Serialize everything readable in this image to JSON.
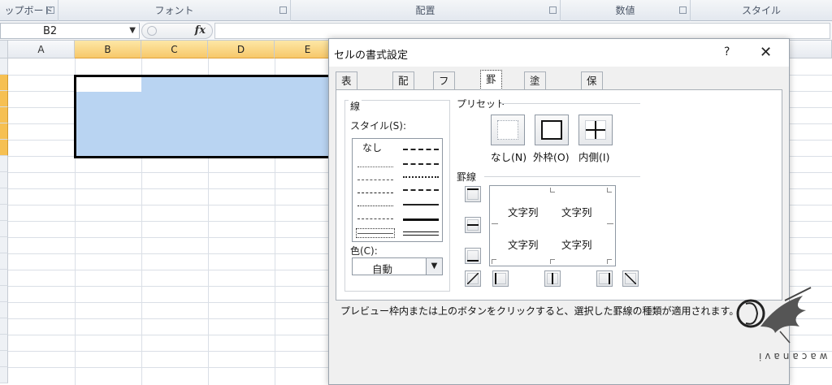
{
  "ribbon": {
    "groups": [
      {
        "label": "ップボード"
      },
      {
        "label": "フォント"
      },
      {
        "label": "配置"
      },
      {
        "label": "数値"
      },
      {
        "label": "スタイル"
      }
    ]
  },
  "formula_bar": {
    "name_box": "B2",
    "fx_label": "fx",
    "formula": ""
  },
  "sheet": {
    "columns": [
      "A",
      "B",
      "C",
      "D",
      "E"
    ],
    "selected_columns": [
      "B",
      "C",
      "D",
      "E"
    ],
    "active_cell": "B2"
  },
  "dialog": {
    "title": "セルの書式設定",
    "help": "?",
    "close": "✕",
    "tabs": [
      {
        "label": "表示形式"
      },
      {
        "label": "配置"
      },
      {
        "label": "フォント"
      },
      {
        "label": "罫線"
      },
      {
        "label": "塗りつぶし"
      },
      {
        "label": "保護"
      }
    ],
    "active_tab": "罫線",
    "line_group_title": "線",
    "style_label": "スタイル(S):",
    "style_none": "なし",
    "color_label": "色(C):",
    "color_value": "自動",
    "preset_title": "プリセット",
    "presets": [
      {
        "label": "なし(N)"
      },
      {
        "label": "外枠(O)"
      },
      {
        "label": "内側(I)"
      }
    ],
    "border_title": "罫線",
    "preview_texts": [
      "文字列",
      "文字列",
      "文字列",
      "文字列"
    ],
    "help_text": "プレビュー枠内または上のボタンをクリックすると、選択した罫線の種類が適用されます。"
  },
  "watermark": {
    "name": "wacanavi"
  },
  "colors": {
    "selection_fill": "#b9d4f2",
    "header_selected": "#f7c86a",
    "dialog_bg": "#f0f0f0"
  }
}
